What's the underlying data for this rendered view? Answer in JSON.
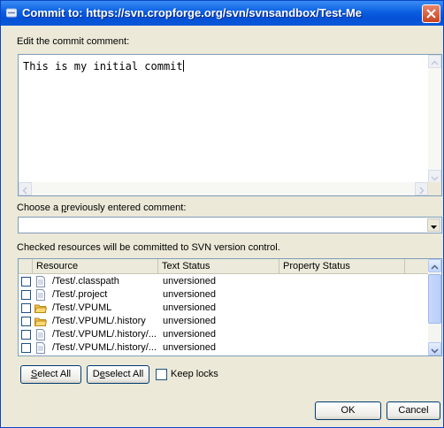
{
  "window": {
    "title": "Commit to: https://svn.cropforge.org/svn/svnsandbox/Test-Me",
    "title_icon": "svn-commit-icon",
    "close_icon": "close-icon"
  },
  "comment": {
    "label": "Edit the commit comment:",
    "value": "This is my initial commit"
  },
  "previous": {
    "label_pre": "Choose a ",
    "label_mnemonic": "p",
    "label_post": "reviously entered comment:",
    "selected": ""
  },
  "resources": {
    "label": "Checked resources will be committed to SVN version control.",
    "columns": [
      "Resource",
      "Text Status",
      "Property Status"
    ],
    "rows": [
      {
        "checked": false,
        "icon": "file-icon",
        "resource": "/Test/.classpath",
        "text_status": "unversioned",
        "property_status": ""
      },
      {
        "checked": false,
        "icon": "file-icon",
        "resource": "/Test/.project",
        "text_status": "unversioned",
        "property_status": ""
      },
      {
        "checked": false,
        "icon": "folder-icon",
        "resource": "/Test/.VPUML",
        "text_status": "unversioned",
        "property_status": ""
      },
      {
        "checked": false,
        "icon": "folder-icon",
        "resource": "/Test/.VPUML/.history",
        "text_status": "unversioned",
        "property_status": ""
      },
      {
        "checked": false,
        "icon": "file-icon",
        "resource": "/Test/.VPUML/.history/...",
        "text_status": "unversioned",
        "property_status": ""
      },
      {
        "checked": false,
        "icon": "file-icon",
        "resource": "/Test/.VPUML/.history/...",
        "text_status": "unversioned",
        "property_status": ""
      }
    ]
  },
  "buttons": {
    "select_all_mn": "S",
    "select_all_rest": "elect All",
    "deselect_all_pre": "D",
    "deselect_all_mn": "e",
    "deselect_all_rest": "select All",
    "keep_locks": "Keep locks",
    "keep_locks_checked": false,
    "ok": "OK",
    "cancel": "Cancel"
  },
  "colors": {
    "titlebar": "#0a5fe0",
    "dialog_bg": "#ece9d8",
    "border": "#7f9db9"
  }
}
